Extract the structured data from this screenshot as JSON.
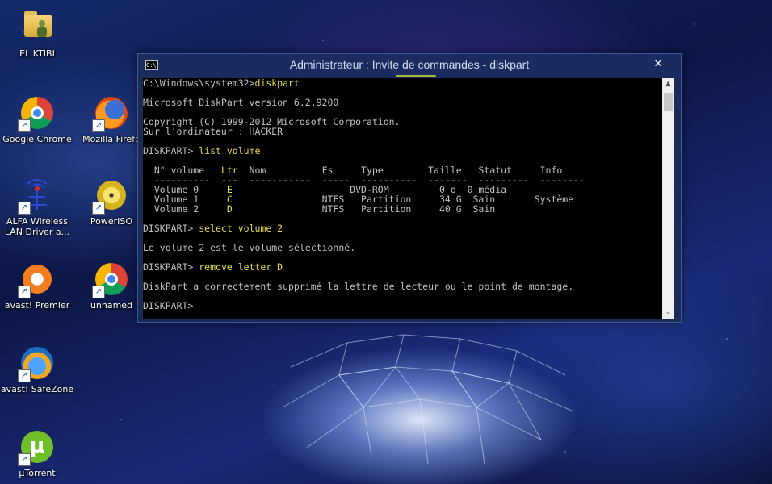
{
  "desktop": {
    "icons": [
      {
        "label": "EL KTIBI",
        "icon": "folder-user-icon"
      },
      {
        "label": "Google Chrome",
        "icon": "chrome-icon"
      },
      {
        "label": "Mozilla Firefo",
        "icon": "firefox-icon"
      },
      {
        "label": "ALFA Wireless LAN Driver a...",
        "icon": "alfa-wireless-icon"
      },
      {
        "label": "PowerISO",
        "icon": "poweriso-icon"
      },
      {
        "label": "avast! Premier",
        "icon": "avast-icon"
      },
      {
        "label": "unnamed",
        "icon": "chrome-icon"
      },
      {
        "label": "avast! SafeZone",
        "icon": "safezone-icon"
      },
      {
        "label": "µTorrent",
        "icon": "utorrent-icon"
      }
    ],
    "shortcut_glyph": "↗"
  },
  "window": {
    "title": "Administrateur : Invite de commandes - diskpart",
    "icon_text": "C:\\",
    "close_glyph": "✕",
    "scroll_up_glyph": "▲",
    "scroll_down_glyph": "⌄"
  },
  "console": {
    "lines": [
      {
        "text": "C:\\Windows\\system32>",
        "cmd": "diskpart"
      },
      {
        "text": ""
      },
      {
        "text": "Microsoft DiskPart version 6.2.9200"
      },
      {
        "text": ""
      },
      {
        "text": "Copyright (C) 1999-2012 Microsoft Corporation."
      },
      {
        "text": "Sur l'ordinateur : HACKER"
      },
      {
        "text": ""
      },
      {
        "text": "DISKPART> ",
        "cmd": "list volume"
      },
      {
        "text": ""
      },
      {
        "text": "  N° volume   ",
        "ltr": "Ltr",
        "rest": "  Nom          Fs     Type        Taille   Statut     Info"
      },
      {
        "text": "  ----------  ",
        "ltr": "---",
        "rest": "  -----------  -----  ----------  -------  ---------  --------"
      },
      {
        "text": "  Volume 0     ",
        "ltr": "E",
        "rest": "                     DVD-ROM         0 o  0 média"
      },
      {
        "text": "  Volume 1     ",
        "ltr": "C",
        "rest": "                NTFS   Partition     34 G  Sain       Système"
      },
      {
        "text": "  Volume 2     ",
        "ltr": "D",
        "rest": "                NTFS   Partition     40 G  Sain"
      },
      {
        "text": ""
      },
      {
        "text": "DISKPART> ",
        "cmd": "select volume 2"
      },
      {
        "text": ""
      },
      {
        "text": "Le volume 2 est le volume sélectionné."
      },
      {
        "text": ""
      },
      {
        "text": "DISKPART> ",
        "cmd": "remove letter D"
      },
      {
        "text": ""
      },
      {
        "text": "DiskPart a correctement supprimé la lettre de lecteur ou le point de montage."
      },
      {
        "text": ""
      },
      {
        "text": "DISKPART> "
      }
    ]
  },
  "colors": {
    "console_text": "#c0c0c0",
    "console_highlight": "#e6d94a",
    "console_bg": "#000000"
  }
}
